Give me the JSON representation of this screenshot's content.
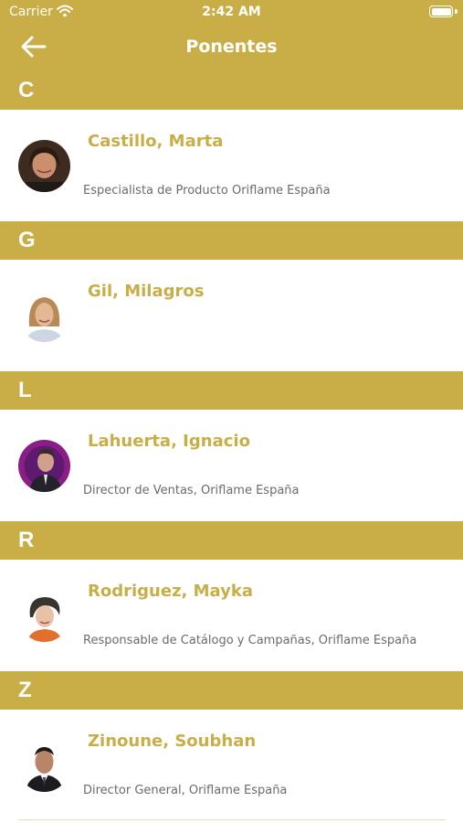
{
  "status_bar": {
    "carrier": "Carrier",
    "time": "2:42 AM",
    "icons": [
      "wifi-icon",
      "battery-icon"
    ]
  },
  "nav": {
    "title": "Ponentes",
    "back_icon": "arrow-left-icon"
  },
  "colors": {
    "accent": "#c9ae47",
    "background": "#ffffff",
    "role_text": "#6b6b6b"
  },
  "sections": [
    {
      "letter": "C",
      "speakers": [
        {
          "name": "Castillo, Marta",
          "role": "Especialista de Producto Oriflame España"
        }
      ]
    },
    {
      "letter": "G",
      "speakers": [
        {
          "name": "Gil, Milagros",
          "role": ""
        }
      ]
    },
    {
      "letter": "L",
      "speakers": [
        {
          "name": "Lahuerta, Ignacio",
          "role": "Director de Ventas, Oriflame España"
        }
      ]
    },
    {
      "letter": "R",
      "speakers": [
        {
          "name": "Rodriguez, Mayka",
          "role": "Responsable de Catálogo y Campañas, Oriflame España"
        }
      ]
    },
    {
      "letter": "Z",
      "speakers": [
        {
          "name": "Zinoune, Soubhan",
          "role": "Director General, Oriflame España"
        }
      ]
    }
  ]
}
